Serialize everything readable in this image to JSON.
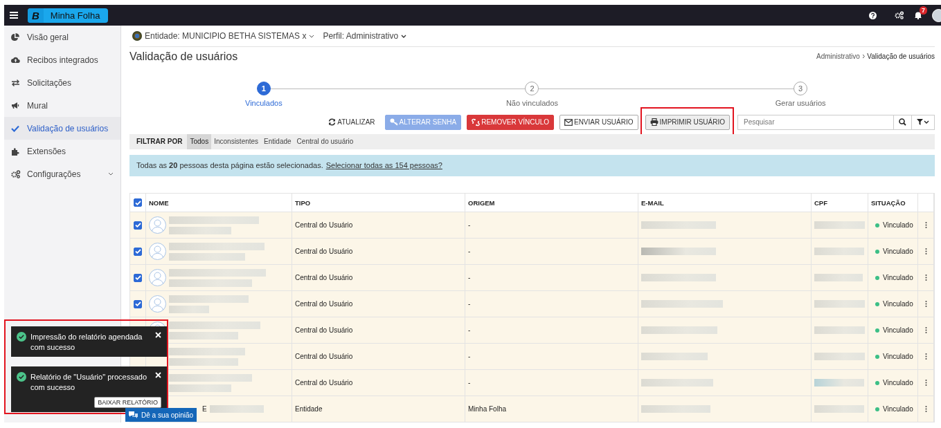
{
  "app": {
    "brand_letter": "B",
    "title": "Minha Folha",
    "notifications": "7"
  },
  "sidebar": {
    "items": [
      {
        "label": "Visão geral",
        "selected": false,
        "has_submenu": false
      },
      {
        "label": "Recibos integrados",
        "selected": false,
        "has_submenu": false
      },
      {
        "label": "Solicitações",
        "selected": false,
        "has_submenu": false
      },
      {
        "label": "Mural",
        "selected": false,
        "has_submenu": false
      },
      {
        "label": "Validação de usuários",
        "selected": true,
        "has_submenu": false
      },
      {
        "label": "Extensões",
        "selected": false,
        "has_submenu": false
      },
      {
        "label": "Configurações",
        "selected": false,
        "has_submenu": true
      }
    ]
  },
  "context": {
    "entity": "Entidade: MUNICIPIO BETHA SISTEMAS x",
    "profile": "Perfil: Administrativo"
  },
  "page": {
    "title": "Validação de usuários",
    "breadcrumb": [
      "Administrativo",
      "Validação de usuários"
    ]
  },
  "steps": [
    {
      "number": "1",
      "label": "Vinculados",
      "selected": true
    },
    {
      "number": "2",
      "label": "Não vinculados",
      "selected": false
    },
    {
      "number": "3",
      "label": "Gerar usuários",
      "selected": false
    }
  ],
  "toolbar": {
    "buttons": [
      {
        "label": "ATUALIZAR",
        "kind": "link",
        "disabled": false,
        "highlighted": false
      },
      {
        "label": "ALTERAR SENHA",
        "kind": "primary",
        "disabled": true,
        "highlighted": false
      },
      {
        "label": "REMOVER VÍNCULO",
        "kind": "danger",
        "disabled": false,
        "highlighted": false
      },
      {
        "label": "ENVIAR USUÁRIO",
        "kind": "default",
        "disabled": false,
        "highlighted": false
      },
      {
        "label": "IMPRIMIR USUÁRIO",
        "kind": "light",
        "disabled": false,
        "highlighted": true
      }
    ],
    "search": {
      "placeholder": "Pesquisar"
    }
  },
  "filters": {
    "label": "FILTRAR POR",
    "options": [
      {
        "label": "Todos",
        "selected": true
      },
      {
        "label": "Inconsistentes",
        "selected": false
      },
      {
        "label": "Entidade",
        "selected": false
      },
      {
        "label": "Central do usuário",
        "selected": false
      }
    ]
  },
  "alert": {
    "text": "Todas as **20** pessoas desta página estão selecionadas.",
    "link": "Selecionar todas as 154 pessoas?"
  },
  "table": {
    "all_checked": true,
    "columns": [
      "NOME",
      "TIPO",
      "ORIGEM",
      "E-MAIL",
      "CPF",
      "SITUAÇÃO"
    ],
    "rows": [
      {
        "checked": true,
        "tipo": "Central do Usuário",
        "origem": "-",
        "situacao": "Vinculado",
        "color": "#3cbf86"
      },
      {
        "checked": true,
        "tipo": "Central do Usuário",
        "origem": "-",
        "situacao": "Vinculado",
        "color": "#3cbf86"
      },
      {
        "checked": true,
        "tipo": "Central do Usuário",
        "origem": "-",
        "situacao": "Vinculado",
        "color": "#3cbf86"
      },
      {
        "checked": true,
        "tipo": "Central do Usuário",
        "origem": "-",
        "situacao": "Vinculado",
        "color": "#3cbf86"
      },
      {
        "tipo": "Central do Usuário",
        "origem": "-",
        "situacao": "Vinculado",
        "color": "#3cbf86"
      },
      {
        "tipo": "Central do Usuário",
        "origem": "-",
        "situacao": "Vinculado",
        "color": "#3cbf86"
      },
      {
        "tipo": "Central do Usuário",
        "origem": "-",
        "situacao": "Vinculado",
        "color": "#3cbf86"
      },
      {
        "name_fragment": "E",
        "tipo": "Entidade",
        "origem": "Minha Folha",
        "situacao": "Vinculado",
        "color": "#3cbf86"
      }
    ]
  },
  "feedback_button": "Dê a sua opinião",
  "toasts": [
    {
      "message": "Impressão do relatório agendada com sucesso"
    },
    {
      "message": "Relatório de \"Usuário\" processado com sucesso",
      "action": "BAIXAR RELATÓRIO"
    }
  ]
}
